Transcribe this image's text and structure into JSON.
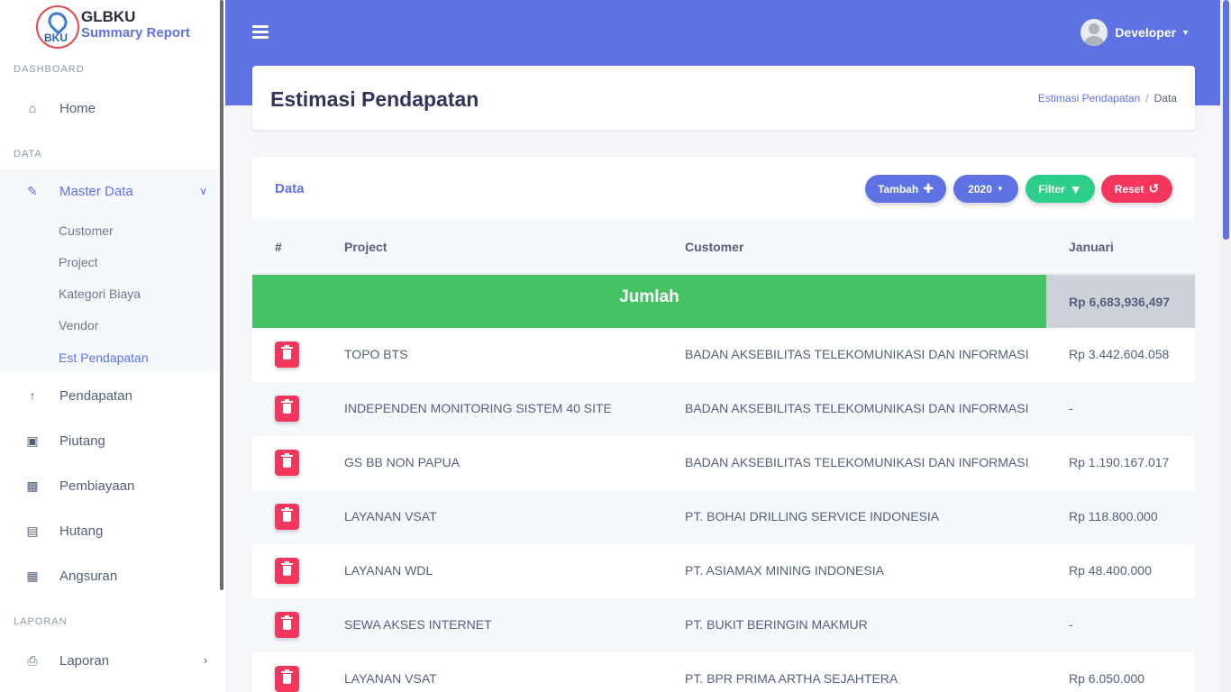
{
  "brand": {
    "logo_text": "BKU",
    "title": "GLBKU",
    "subtitle": "Summary Report"
  },
  "sidebar": {
    "headings": {
      "dashboard": "DASHBOARD",
      "data": "DATA",
      "laporan": "LAPORAN"
    },
    "items": {
      "home": "Home",
      "master_data": "Master Data",
      "pendapatan": "Pendapatan",
      "piutang": "Piutang",
      "pembiayaan": "Pembiayaan",
      "hutang": "Hutang",
      "angsuran": "Angsuran",
      "laporan": "Laporan"
    },
    "submenu": [
      "Customer",
      "Project",
      "Kategori Biaya",
      "Vendor",
      "Est Pendapatan"
    ],
    "active_submenu": "Est Pendapatan"
  },
  "topbar": {
    "user": "Developer"
  },
  "header": {
    "title": "Estimasi Pendapatan",
    "breadcrumb": [
      "Estimasi Pendapatan",
      "Data"
    ]
  },
  "card": {
    "title": "Data",
    "buttons": {
      "tambah": "Tambah",
      "year": "2020",
      "filter": "Filter",
      "reset": "Reset"
    }
  },
  "table": {
    "columns": [
      "#",
      "Project",
      "Customer",
      "Januari"
    ],
    "total_label": "Jumlah",
    "total_value": "Rp 6,683,936,497",
    "rows": [
      {
        "project": "TOPO BTS",
        "customer": "BADAN AKSEBILITAS TELEKOMUNIKASI DAN INFORMASI",
        "januari": "Rp 3.442.604.058"
      },
      {
        "project": "INDEPENDEN MONITORING SISTEM 40 SITE",
        "customer": "BADAN AKSEBILITAS TELEKOMUNIKASI DAN INFORMASI",
        "januari": "-"
      },
      {
        "project": "GS BB NON PAPUA",
        "customer": "BADAN AKSEBILITAS TELEKOMUNIKASI DAN INFORMASI",
        "januari": "Rp 1.190.167.017"
      },
      {
        "project": "LAYANAN VSAT",
        "customer": "PT. BOHAI DRILLING SERVICE INDONESIA",
        "januari": "Rp 118.800.000"
      },
      {
        "project": "LAYANAN WDL",
        "customer": "PT. ASIAMAX MINING INDONESIA",
        "januari": "Rp 48.400.000"
      },
      {
        "project": "SEWA AKSES INTERNET",
        "customer": "PT. BUKIT BERINGIN MAKMUR",
        "januari": "-"
      },
      {
        "project": "LAYANAN VSAT",
        "customer": "PT. BPR PRIMA ARTHA SEJAHTERA",
        "januari": "Rp 6.050.000"
      }
    ]
  },
  "colors": {
    "primary": "#5e72e4",
    "success": "#2dce89",
    "danger": "#f5365c",
    "total_green": "#45c263"
  }
}
